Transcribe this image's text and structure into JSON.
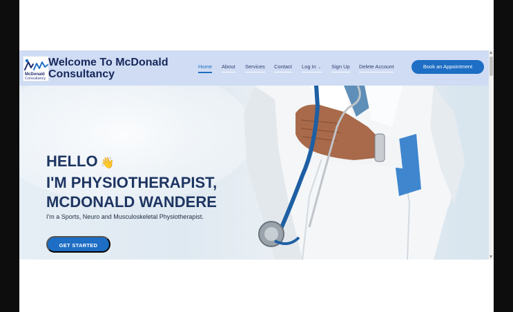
{
  "logo": {
    "name": "McDonald",
    "subtitle": "Consultancy"
  },
  "brand": {
    "line1": "Welcome To McDonald",
    "line2": "Consultancy"
  },
  "nav": {
    "home": "Home",
    "about": "About",
    "services": "Services",
    "contact": "Contact",
    "login": "Log In",
    "signup": "Sign Up",
    "delete": "Delete Account"
  },
  "header_cta": "Book an Appointment",
  "hero": {
    "line1": "HELLO",
    "wave": "👋",
    "line2": "I'M PHYSIOTHERAPIST,",
    "line3": "MCDONALD WANDERE",
    "intro": "I'm a Sports, Neuro and Musculoskeletal Physiotherapist.",
    "cta": "GET STARTED"
  },
  "colors": {
    "accent": "#1d6ec4",
    "header_bg": "#cfdcf3",
    "headline": "#1e3562"
  }
}
